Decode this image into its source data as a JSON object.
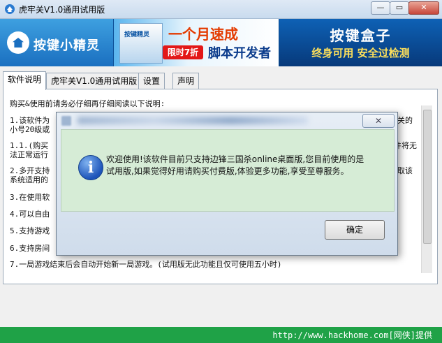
{
  "window": {
    "title": "虎牢关V1.0通用试用版",
    "min_label": "—",
    "max_label": "▭",
    "close_label": "✕"
  },
  "banner": {
    "logo_text": "按键小精灵",
    "box_label": "按键精灵",
    "promo_headline": "一个月速成",
    "promo_tag": "限时7折",
    "promo_sub": "脚本开发者",
    "right_title": "按键盒子",
    "right_sub": "终身可用 安全过检测"
  },
  "tabs": [
    {
      "label": "软件说明",
      "active": true
    },
    {
      "label": "虎牢关V1.0通用试用版",
      "active": false
    },
    {
      "label": "设置",
      "active": false
    },
    {
      "label": "声明",
      "active": false
    }
  ],
  "content": {
    "heading": "购买&使用前请务必仔细再仔细阅读以下说明:",
    "lines": [
      {
        "left": "1.该软件为",
        "right": "关的",
        "blurred": true
      },
      {
        "left": "小号20级或",
        "right": "",
        "blurred": true
      },
      {
        "left": "1.1.(购买",
        "right": "件将无",
        "blurred": true
      },
      {
        "left": "法正常运行",
        "right": "",
        "blurred": true
      },
      {
        "left": "2.多开支持",
        "right": "取该",
        "blurred": true
      },
      {
        "left": "系统适用的",
        "right": "",
        "blurred": true
      },
      {
        "left": "3.在使用软",
        "right": "",
        "blurred": true
      },
      {
        "left": "4.可以自由",
        "right": "",
        "blurred": true
      },
      {
        "left": "5.支持游戏",
        "right": "",
        "blurred": true
      },
      {
        "left": "6.支持房间",
        "right": "",
        "blurred": true
      }
    ],
    "last_line": "7.一局游戏结束后会自动开始新一局游戏。(试用版无此功能且仅可使用五小时)"
  },
  "dialog": {
    "close_label": "✕",
    "message": "欢迎使用!该软件目前只支持边锋三国杀online桌面版,您目前使用的是试用版,如果觉得好用请购买付费版,体验更多功能,享受至尊服务。",
    "ok_label": "确定"
  },
  "status": {
    "text": "http://www.hackhome.com[网侠]提供"
  },
  "colors": {
    "status_bar": "#1fa247",
    "dialog_body": "#d6ecd6",
    "banner": "#0c4f97"
  }
}
